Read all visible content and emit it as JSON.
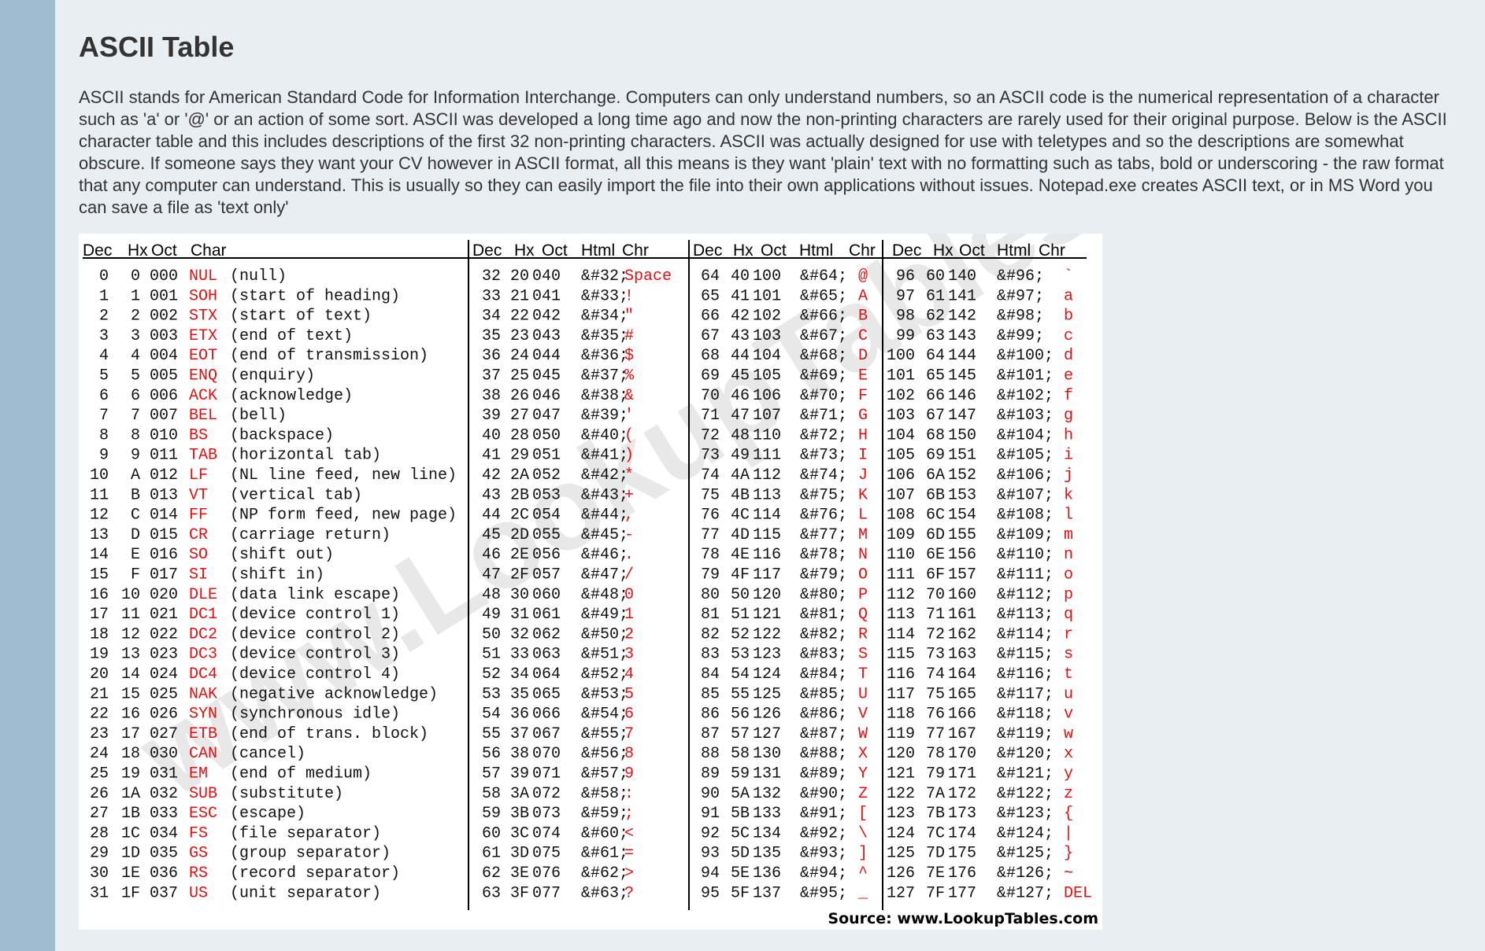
{
  "page": {
    "title": "ASCII Table",
    "intro": "ASCII stands for American Standard Code for Information Interchange. Computers can only understand numbers, so an ASCII code is the numerical representation of a character such as 'a' or '@' or an action of some sort. ASCII was developed a long time ago and now the non-printing characters are rarely used for their original purpose. Below is the ASCII character table and this includes descriptions of the first 32 non-printing characters. ASCII was actually designed for use with teletypes and so the descriptions are somewhat obscure. If someone says they want your CV however in ASCII format, all this means is they want 'plain' text with no formatting such as tabs, bold or underscoring - the raw format that any computer can understand. This is usually so they can easily import the file into their own applications without issues. Notepad.exe creates ASCII text, or in MS Word you can save a file as 'text only'"
  },
  "colors": {
    "sidebar": "#9fbcd1",
    "background": "#e9eef3",
    "char_red": "#e01010"
  },
  "table": {
    "headers": [
      [
        "Dec",
        "Hx",
        "Oct",
        "Char"
      ],
      [
        "Dec",
        "Hx",
        "Oct",
        "Html",
        "Chr"
      ],
      [
        "Dec",
        "Hx",
        "Oct",
        "Html",
        "Chr"
      ],
      [
        "Dec",
        "Hx",
        "Oct",
        "Html",
        "Chr"
      ]
    ],
    "control_rows": [
      [
        "0",
        "0",
        "000",
        "NUL",
        "(null)"
      ],
      [
        "1",
        "1",
        "001",
        "SOH",
        "(start of heading)"
      ],
      [
        "2",
        "2",
        "002",
        "STX",
        "(start of text)"
      ],
      [
        "3",
        "3",
        "003",
        "ETX",
        "(end of text)"
      ],
      [
        "4",
        "4",
        "004",
        "EOT",
        "(end of transmission)"
      ],
      [
        "5",
        "5",
        "005",
        "ENQ",
        "(enquiry)"
      ],
      [
        "6",
        "6",
        "006",
        "ACK",
        "(acknowledge)"
      ],
      [
        "7",
        "7",
        "007",
        "BEL",
        "(bell)"
      ],
      [
        "8",
        "8",
        "010",
        "BS",
        "(backspace)"
      ],
      [
        "9",
        "9",
        "011",
        "TAB",
        "(horizontal tab)"
      ],
      [
        "10",
        "A",
        "012",
        "LF",
        "(NL line feed, new line)"
      ],
      [
        "11",
        "B",
        "013",
        "VT",
        "(vertical tab)"
      ],
      [
        "12",
        "C",
        "014",
        "FF",
        "(NP form feed, new page)"
      ],
      [
        "13",
        "D",
        "015",
        "CR",
        "(carriage return)"
      ],
      [
        "14",
        "E",
        "016",
        "SO",
        "(shift out)"
      ],
      [
        "15",
        "F",
        "017",
        "SI",
        "(shift in)"
      ],
      [
        "16",
        "10",
        "020",
        "DLE",
        "(data link escape)"
      ],
      [
        "17",
        "11",
        "021",
        "DC1",
        "(device control 1)"
      ],
      [
        "18",
        "12",
        "022",
        "DC2",
        "(device control 2)"
      ],
      [
        "19",
        "13",
        "023",
        "DC3",
        "(device control 3)"
      ],
      [
        "20",
        "14",
        "024",
        "DC4",
        "(device control 4)"
      ],
      [
        "21",
        "15",
        "025",
        "NAK",
        "(negative acknowledge)"
      ],
      [
        "22",
        "16",
        "026",
        "SYN",
        "(synchronous idle)"
      ],
      [
        "23",
        "17",
        "027",
        "ETB",
        "(end of trans. block)"
      ],
      [
        "24",
        "18",
        "030",
        "CAN",
        "(cancel)"
      ],
      [
        "25",
        "19",
        "031",
        "EM",
        "(end of medium)"
      ],
      [
        "26",
        "1A",
        "032",
        "SUB",
        "(substitute)"
      ],
      [
        "27",
        "1B",
        "033",
        "ESC",
        "(escape)"
      ],
      [
        "28",
        "1C",
        "034",
        "FS",
        "(file separator)"
      ],
      [
        "29",
        "1D",
        "035",
        "GS",
        "(group separator)"
      ],
      [
        "30",
        "1E",
        "036",
        "RS",
        "(record separator)"
      ],
      [
        "31",
        "1F",
        "037",
        "US",
        "(unit separator)"
      ]
    ],
    "printable_blocks": [
      [
        [
          "32",
          "20",
          "040",
          "&#32;",
          "Space"
        ],
        [
          "33",
          "21",
          "041",
          "&#33;",
          "!"
        ],
        [
          "34",
          "22",
          "042",
          "&#34;",
          "\""
        ],
        [
          "35",
          "23",
          "043",
          "&#35;",
          "#"
        ],
        [
          "36",
          "24",
          "044",
          "&#36;",
          "$"
        ],
        [
          "37",
          "25",
          "045",
          "&#37;",
          "%"
        ],
        [
          "38",
          "26",
          "046",
          "&#38;",
          "&"
        ],
        [
          "39",
          "27",
          "047",
          "&#39;",
          "'"
        ],
        [
          "40",
          "28",
          "050",
          "&#40;",
          "("
        ],
        [
          "41",
          "29",
          "051",
          "&#41;",
          ")"
        ],
        [
          "42",
          "2A",
          "052",
          "&#42;",
          "*"
        ],
        [
          "43",
          "2B",
          "053",
          "&#43;",
          "+"
        ],
        [
          "44",
          "2C",
          "054",
          "&#44;",
          ","
        ],
        [
          "45",
          "2D",
          "055",
          "&#45;",
          "-"
        ],
        [
          "46",
          "2E",
          "056",
          "&#46;",
          "."
        ],
        [
          "47",
          "2F",
          "057",
          "&#47;",
          "/"
        ],
        [
          "48",
          "30",
          "060",
          "&#48;",
          "0"
        ],
        [
          "49",
          "31",
          "061",
          "&#49;",
          "1"
        ],
        [
          "50",
          "32",
          "062",
          "&#50;",
          "2"
        ],
        [
          "51",
          "33",
          "063",
          "&#51;",
          "3"
        ],
        [
          "52",
          "34",
          "064",
          "&#52;",
          "4"
        ],
        [
          "53",
          "35",
          "065",
          "&#53;",
          "5"
        ],
        [
          "54",
          "36",
          "066",
          "&#54;",
          "6"
        ],
        [
          "55",
          "37",
          "067",
          "&#55;",
          "7"
        ],
        [
          "56",
          "38",
          "070",
          "&#56;",
          "8"
        ],
        [
          "57",
          "39",
          "071",
          "&#57;",
          "9"
        ],
        [
          "58",
          "3A",
          "072",
          "&#58;",
          ":"
        ],
        [
          "59",
          "3B",
          "073",
          "&#59;",
          ";"
        ],
        [
          "60",
          "3C",
          "074",
          "&#60;",
          "<"
        ],
        [
          "61",
          "3D",
          "075",
          "&#61;",
          "="
        ],
        [
          "62",
          "3E",
          "076",
          "&#62;",
          ">"
        ],
        [
          "63",
          "3F",
          "077",
          "&#63;",
          "?"
        ]
      ],
      [
        [
          "64",
          "40",
          "100",
          "&#64;",
          "@"
        ],
        [
          "65",
          "41",
          "101",
          "&#65;",
          "A"
        ],
        [
          "66",
          "42",
          "102",
          "&#66;",
          "B"
        ],
        [
          "67",
          "43",
          "103",
          "&#67;",
          "C"
        ],
        [
          "68",
          "44",
          "104",
          "&#68;",
          "D"
        ],
        [
          "69",
          "45",
          "105",
          "&#69;",
          "E"
        ],
        [
          "70",
          "46",
          "106",
          "&#70;",
          "F"
        ],
        [
          "71",
          "47",
          "107",
          "&#71;",
          "G"
        ],
        [
          "72",
          "48",
          "110",
          "&#72;",
          "H"
        ],
        [
          "73",
          "49",
          "111",
          "&#73;",
          "I"
        ],
        [
          "74",
          "4A",
          "112",
          "&#74;",
          "J"
        ],
        [
          "75",
          "4B",
          "113",
          "&#75;",
          "K"
        ],
        [
          "76",
          "4C",
          "114",
          "&#76;",
          "L"
        ],
        [
          "77",
          "4D",
          "115",
          "&#77;",
          "M"
        ],
        [
          "78",
          "4E",
          "116",
          "&#78;",
          "N"
        ],
        [
          "79",
          "4F",
          "117",
          "&#79;",
          "O"
        ],
        [
          "80",
          "50",
          "120",
          "&#80;",
          "P"
        ],
        [
          "81",
          "51",
          "121",
          "&#81;",
          "Q"
        ],
        [
          "82",
          "52",
          "122",
          "&#82;",
          "R"
        ],
        [
          "83",
          "53",
          "123",
          "&#83;",
          "S"
        ],
        [
          "84",
          "54",
          "124",
          "&#84;",
          "T"
        ],
        [
          "85",
          "55",
          "125",
          "&#85;",
          "U"
        ],
        [
          "86",
          "56",
          "126",
          "&#86;",
          "V"
        ],
        [
          "87",
          "57",
          "127",
          "&#87;",
          "W"
        ],
        [
          "88",
          "58",
          "130",
          "&#88;",
          "X"
        ],
        [
          "89",
          "59",
          "131",
          "&#89;",
          "Y"
        ],
        [
          "90",
          "5A",
          "132",
          "&#90;",
          "Z"
        ],
        [
          "91",
          "5B",
          "133",
          "&#91;",
          "["
        ],
        [
          "92",
          "5C",
          "134",
          "&#92;",
          "\\"
        ],
        [
          "93",
          "5D",
          "135",
          "&#93;",
          "]"
        ],
        [
          "94",
          "5E",
          "136",
          "&#94;",
          "^"
        ],
        [
          "95",
          "5F",
          "137",
          "&#95;",
          "_"
        ]
      ],
      [
        [
          "96",
          "60",
          "140",
          "&#96;",
          "`"
        ],
        [
          "97",
          "61",
          "141",
          "&#97;",
          "a"
        ],
        [
          "98",
          "62",
          "142",
          "&#98;",
          "b"
        ],
        [
          "99",
          "63",
          "143",
          "&#99;",
          "c"
        ],
        [
          "100",
          "64",
          "144",
          "&#100;",
          "d"
        ],
        [
          "101",
          "65",
          "145",
          "&#101;",
          "e"
        ],
        [
          "102",
          "66",
          "146",
          "&#102;",
          "f"
        ],
        [
          "103",
          "67",
          "147",
          "&#103;",
          "g"
        ],
        [
          "104",
          "68",
          "150",
          "&#104;",
          "h"
        ],
        [
          "105",
          "69",
          "151",
          "&#105;",
          "i"
        ],
        [
          "106",
          "6A",
          "152",
          "&#106;",
          "j"
        ],
        [
          "107",
          "6B",
          "153",
          "&#107;",
          "k"
        ],
        [
          "108",
          "6C",
          "154",
          "&#108;",
          "l"
        ],
        [
          "109",
          "6D",
          "155",
          "&#109;",
          "m"
        ],
        [
          "110",
          "6E",
          "156",
          "&#110;",
          "n"
        ],
        [
          "111",
          "6F",
          "157",
          "&#111;",
          "o"
        ],
        [
          "112",
          "70",
          "160",
          "&#112;",
          "p"
        ],
        [
          "113",
          "71",
          "161",
          "&#113;",
          "q"
        ],
        [
          "114",
          "72",
          "162",
          "&#114;",
          "r"
        ],
        [
          "115",
          "73",
          "163",
          "&#115;",
          "s"
        ],
        [
          "116",
          "74",
          "164",
          "&#116;",
          "t"
        ],
        [
          "117",
          "75",
          "165",
          "&#117;",
          "u"
        ],
        [
          "118",
          "76",
          "166",
          "&#118;",
          "v"
        ],
        [
          "119",
          "77",
          "167",
          "&#119;",
          "w"
        ],
        [
          "120",
          "78",
          "170",
          "&#120;",
          "x"
        ],
        [
          "121",
          "79",
          "171",
          "&#121;",
          "y"
        ],
        [
          "122",
          "7A",
          "172",
          "&#122;",
          "z"
        ],
        [
          "123",
          "7B",
          "173",
          "&#123;",
          "{"
        ],
        [
          "124",
          "7C",
          "174",
          "&#124;",
          "|"
        ],
        [
          "125",
          "7D",
          "175",
          "&#125;",
          "}"
        ],
        [
          "126",
          "7E",
          "176",
          "&#126;",
          "~"
        ],
        [
          "127",
          "7F",
          "177",
          "&#127;",
          "DEL"
        ]
      ]
    ],
    "source": "Source:  www.LookupTables.com",
    "watermark": "www.LookupTables.com"
  }
}
